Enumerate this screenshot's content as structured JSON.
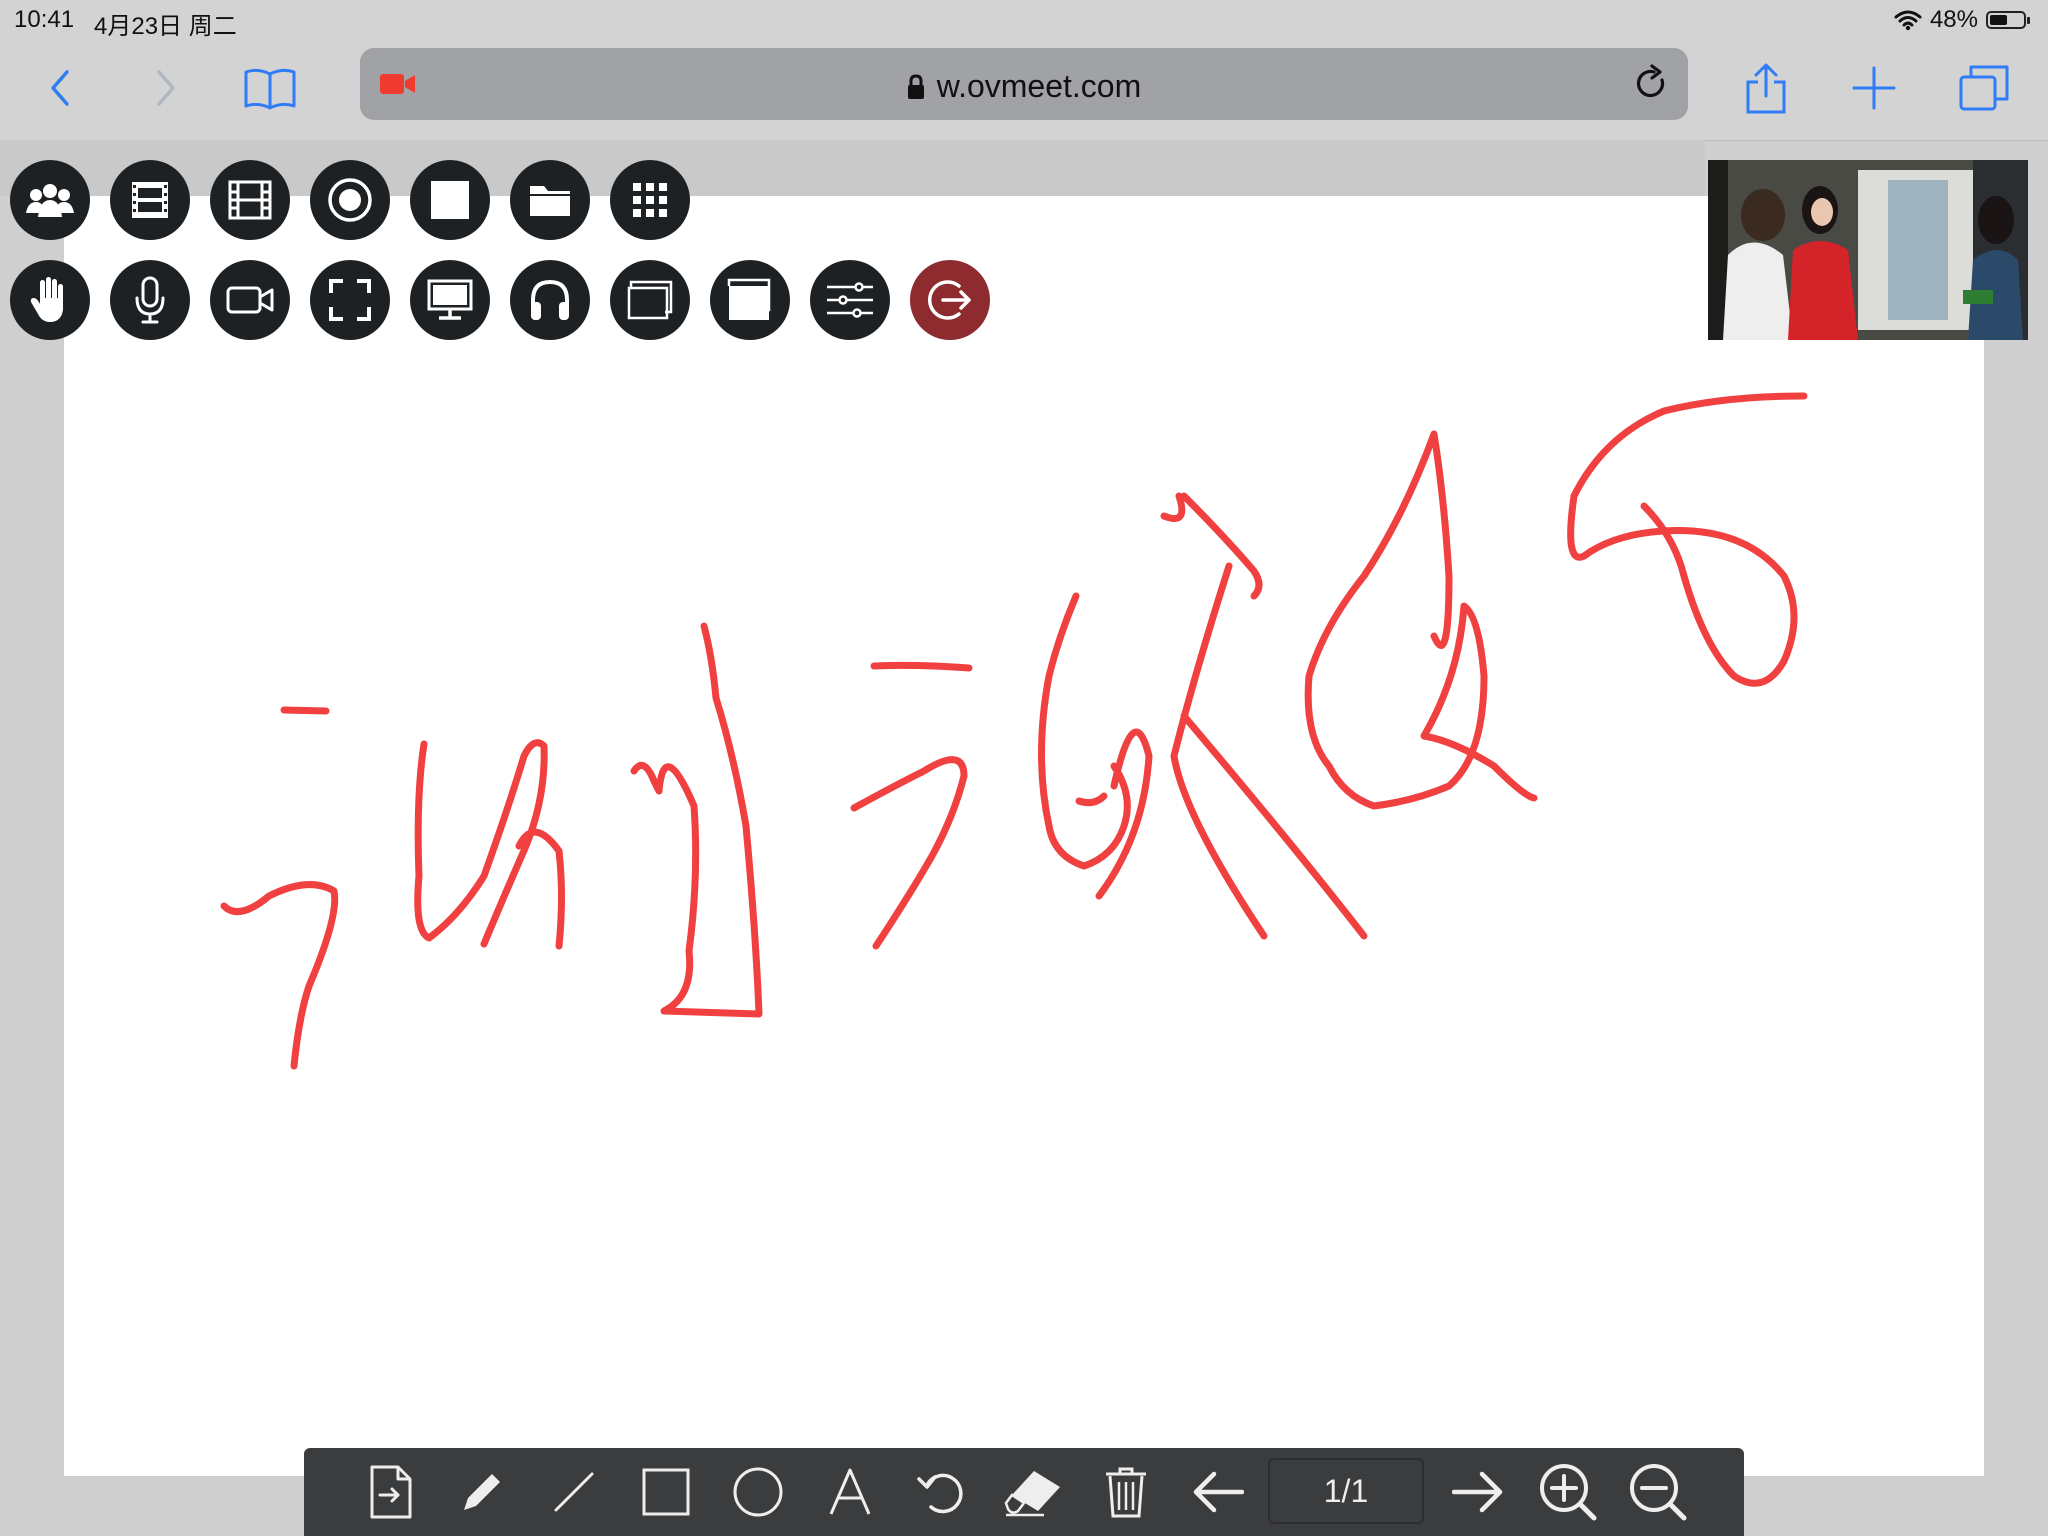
{
  "status_bar": {
    "time": "10:41",
    "date": "4月23日 周二",
    "battery_text": "48%",
    "battery_level": 0.48
  },
  "browser": {
    "url": "w.ovmeet.com",
    "accent_color": "#2f7cf6"
  },
  "meeting_toolbar": {
    "row1_icons": [
      "participants-icon",
      "filmstrip-icon",
      "film-icon",
      "record-icon",
      "stop-square-icon",
      "folder-icon",
      "grid-icon"
    ],
    "row2_icons": [
      "raise-hand-icon",
      "microphone-icon",
      "camera-icon",
      "fullscreen-icon",
      "screen-share-icon",
      "headphones-icon",
      "windows-icon",
      "window-icon",
      "settings-sliders-icon",
      "exit-icon"
    ]
  },
  "whiteboard": {
    "stroke_color": "#f04040",
    "page_indicator": "1/1",
    "tools": [
      "import-file-icon",
      "pencil-icon",
      "line-icon",
      "rectangle-icon",
      "circle-icon",
      "text-icon",
      "undo-icon",
      "eraser-icon",
      "trash-icon",
      "previous-page-icon",
      "next-page-icon",
      "zoom-in-icon",
      "zoom-out-icon"
    ]
  }
}
